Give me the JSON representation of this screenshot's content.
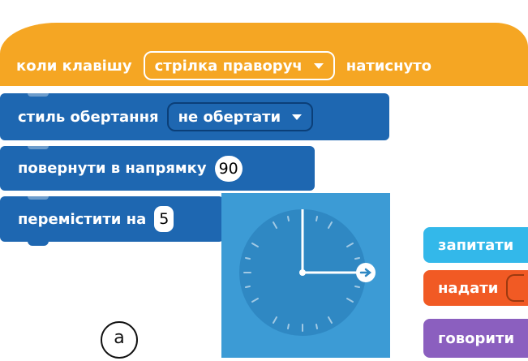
{
  "hat": {
    "label_when": "коли клавішу",
    "key_value": "стрілка праворуч",
    "label_pressed": "натиснуто"
  },
  "rotation": {
    "label": "стиль обертання",
    "value": "не обертати"
  },
  "direction": {
    "label": "повернути в напрямку",
    "value": "90"
  },
  "move": {
    "label": "перемістити на",
    "value": "5"
  },
  "side_blocks": {
    "ask": "запитати",
    "give": "надати",
    "say": "говорити"
  },
  "figure_label": "а",
  "colors": {
    "events": "#F5A623",
    "motion": "#1E67B1",
    "sensing": "#33B8EA",
    "operators": "#F15A24",
    "looks": "#8B5FBF",
    "dial": "#3C9BD5"
  }
}
